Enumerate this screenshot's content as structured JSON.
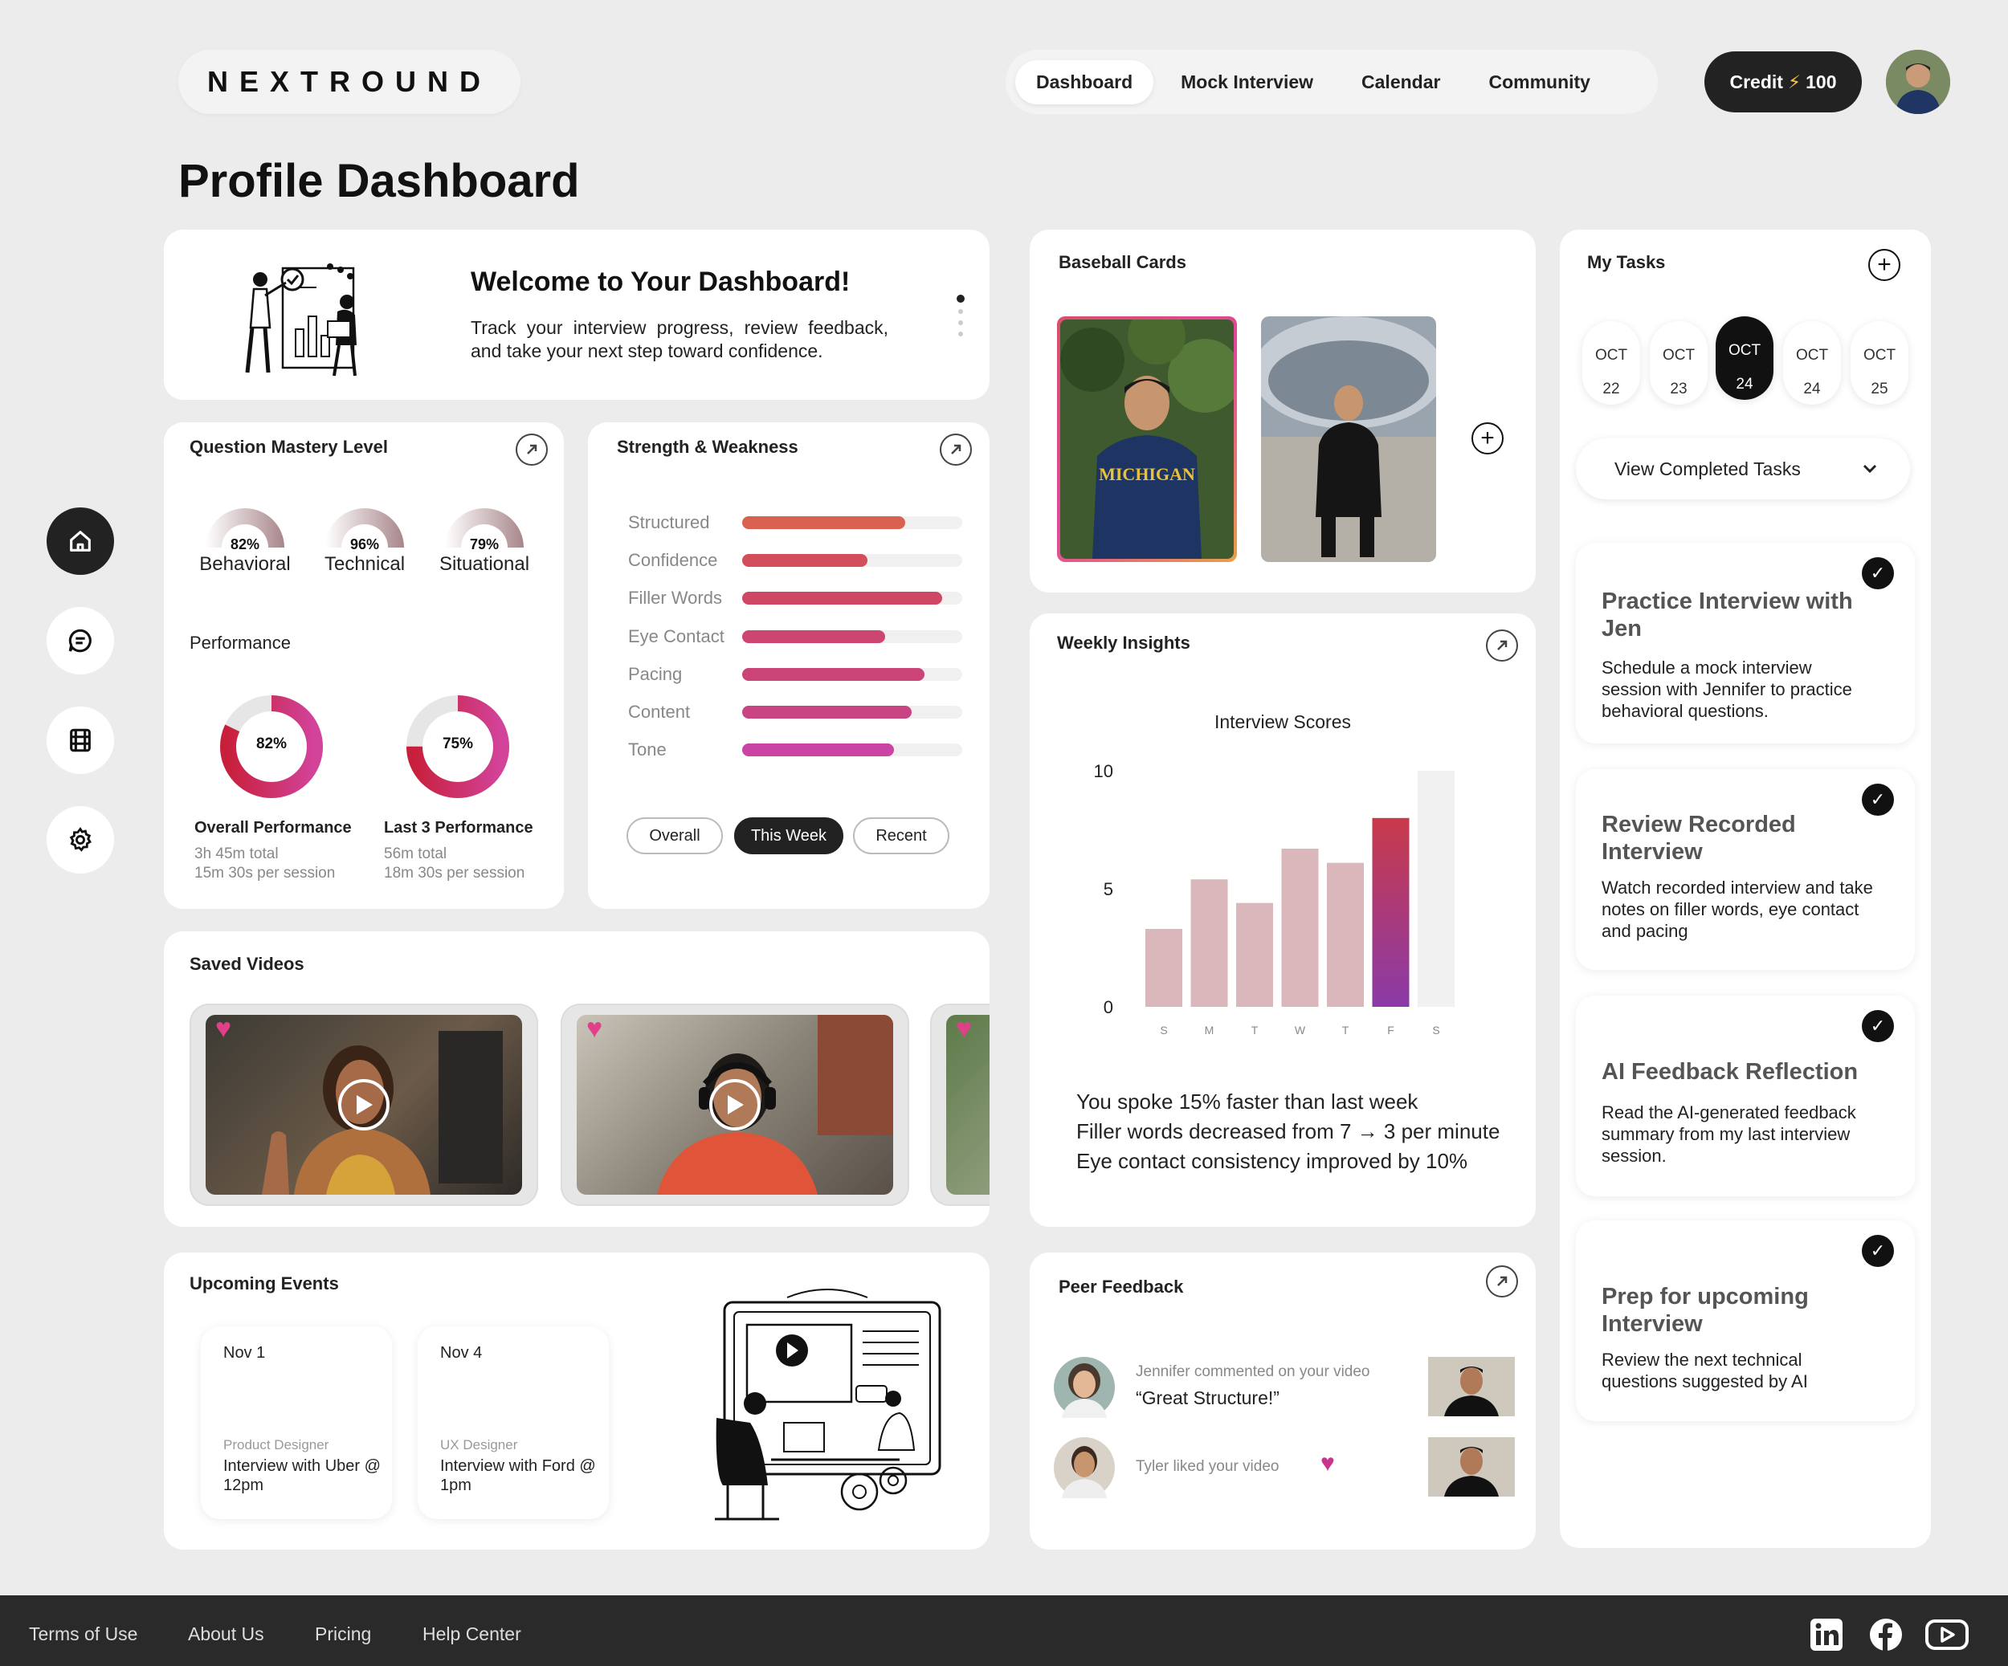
{
  "header": {
    "logo": "NEXTROUND",
    "nav": [
      "Dashboard",
      "Mock Interview",
      "Calendar",
      "Community"
    ],
    "credit_label": "Credit",
    "credit_value": "100"
  },
  "page_title": "Profile Dashboard",
  "welcome": {
    "title": "Welcome to Your Dashboard!",
    "text": "Track your interview progress, review feedback, and take your next step toward confidence."
  },
  "mastery": {
    "title": "Question Mastery Level",
    "gauges": [
      {
        "label": "Behavioral",
        "value": "82%",
        "fraction": 0.82
      },
      {
        "label": "Technical",
        "value": "96%",
        "fraction": 0.96
      },
      {
        "label": "Situational",
        "value": "79%",
        "fraction": 0.79
      }
    ],
    "performance_title": "Performance",
    "donuts": [
      {
        "value": "82%",
        "fraction": 0.82,
        "title": "Overall Performance",
        "sub1": "3h 45m total",
        "sub2": "15m 30s per session"
      },
      {
        "value": "75%",
        "fraction": 0.75,
        "title": "Last 3 Performance",
        "sub1": "56m total",
        "sub2": "18m 30s per session"
      }
    ]
  },
  "strength": {
    "title": "Strength & Weakness",
    "items": [
      {
        "label": "Structured",
        "fraction": 0.74,
        "color": "#d9614f"
      },
      {
        "label": "Confidence",
        "fraction": 0.57,
        "color": "#d44d5a"
      },
      {
        "label": "Filler Words",
        "fraction": 0.91,
        "color": "#cf4762"
      },
      {
        "label": "Eye Contact",
        "fraction": 0.65,
        "color": "#cc4670"
      },
      {
        "label": "Pacing",
        "fraction": 0.83,
        "color": "#ca4478"
      },
      {
        "label": "Content",
        "fraction": 0.77,
        "color": "#c94482"
      },
      {
        "label": "Tone",
        "fraction": 0.69,
        "color": "#c944a4"
      }
    ],
    "filters": [
      "Overall",
      "This Week",
      "Recent"
    ]
  },
  "saved_videos": {
    "title": "Saved Videos"
  },
  "events": {
    "title": "Upcoming Events",
    "items": [
      {
        "date": "Nov 1",
        "role": "Product Designer",
        "desc": "Interview with Uber @ 12pm"
      },
      {
        "date": "Nov 4",
        "role": "UX Designer",
        "desc": "Interview with Ford @ 1pm"
      }
    ]
  },
  "baseball": {
    "title": "Baseball Cards"
  },
  "weekly": {
    "title": "Weekly Insights",
    "insights": [
      "You spoke 15% faster than last week",
      "Filler words decreased from 7 → 3 per minute",
      "Eye contact consistency improved by 10%"
    ]
  },
  "chart_data": {
    "type": "bar",
    "title": "Interview Scores",
    "categories": [
      "S",
      "M",
      "T",
      "W",
      "T",
      "F",
      "S"
    ],
    "values": [
      3.3,
      5.4,
      4.4,
      6.7,
      6.1,
      8.0,
      10.0
    ],
    "ylim": [
      0,
      10
    ],
    "yticks": [
      "10",
      "5",
      "0"
    ],
    "colors": [
      "#d9b7bb",
      "#d9b7bb",
      "#d9b7bb",
      "#d9b7bb",
      "#d9b7bb",
      "#a03a86",
      "#f1f1f1"
    ]
  },
  "peer": {
    "title": "Peer Feedback",
    "items": [
      {
        "text": "Jennifer commented on your video",
        "quote": "“Great Structure!”"
      },
      {
        "text": "Tyler liked your video"
      }
    ]
  },
  "tasks": {
    "title": "My Tasks",
    "dates": [
      {
        "month": "OCT",
        "day": "22"
      },
      {
        "month": "OCT",
        "day": "23"
      },
      {
        "month": "OCT",
        "day": "24"
      },
      {
        "month": "OCT",
        "day": "24"
      },
      {
        "month": "OCT",
        "day": "25"
      }
    ],
    "view_completed": "View Completed Tasks",
    "items": [
      {
        "title": "Practice Interview with Jen",
        "desc": "Schedule a mock interview session with Jennifer to practice behavioral questions."
      },
      {
        "title": "Review Recorded Interview",
        "desc": "Watch recorded interview and take notes on filler words, eye contact and pacing"
      },
      {
        "title": "AI Feedback Reflection",
        "desc": "Read the AI-generated feedback summary from my last interview session."
      },
      {
        "title": "Prep for upcoming Interview",
        "desc": "Review the next technical questions suggested by AI"
      }
    ]
  },
  "footer": {
    "links": [
      "Terms of Use",
      "About Us",
      "Pricing",
      "Help Center"
    ]
  }
}
